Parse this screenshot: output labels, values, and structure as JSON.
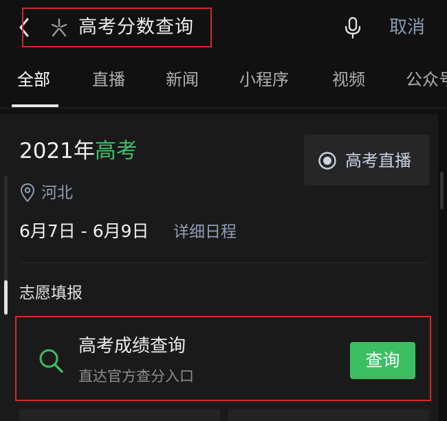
{
  "search": {
    "query": "高考分数查询",
    "cancel_label": "取消"
  },
  "tabs": [
    {
      "label": "全部",
      "active": true
    },
    {
      "label": "直播"
    },
    {
      "label": "新闻"
    },
    {
      "label": "小程序"
    },
    {
      "label": "视频"
    },
    {
      "label": "公众号"
    }
  ],
  "event": {
    "title_prefix": "2021年",
    "title_highlight": "高考",
    "live_label": "高考直播",
    "location": "河北",
    "date_range": "6月7日 - 6月9日",
    "schedule_link": "详细日程"
  },
  "section": {
    "title": "志愿填报"
  },
  "card": {
    "title": "高考成绩查询",
    "subtitle": "直达官方查分入口",
    "button_label": "查询"
  },
  "colors": {
    "background": "#111111",
    "panel": "#1a1a1a",
    "accent_green": "#3cbf63",
    "link_blue_gray": "#8f9db5",
    "annotation_red": "#d32a2a"
  },
  "icons": {
    "back": "chevron-left-icon",
    "sparkle": "sparkle-icon",
    "mic": "microphone-icon",
    "live": "radio-icon",
    "location": "location-pin-icon",
    "card_search": "search-icon"
  }
}
